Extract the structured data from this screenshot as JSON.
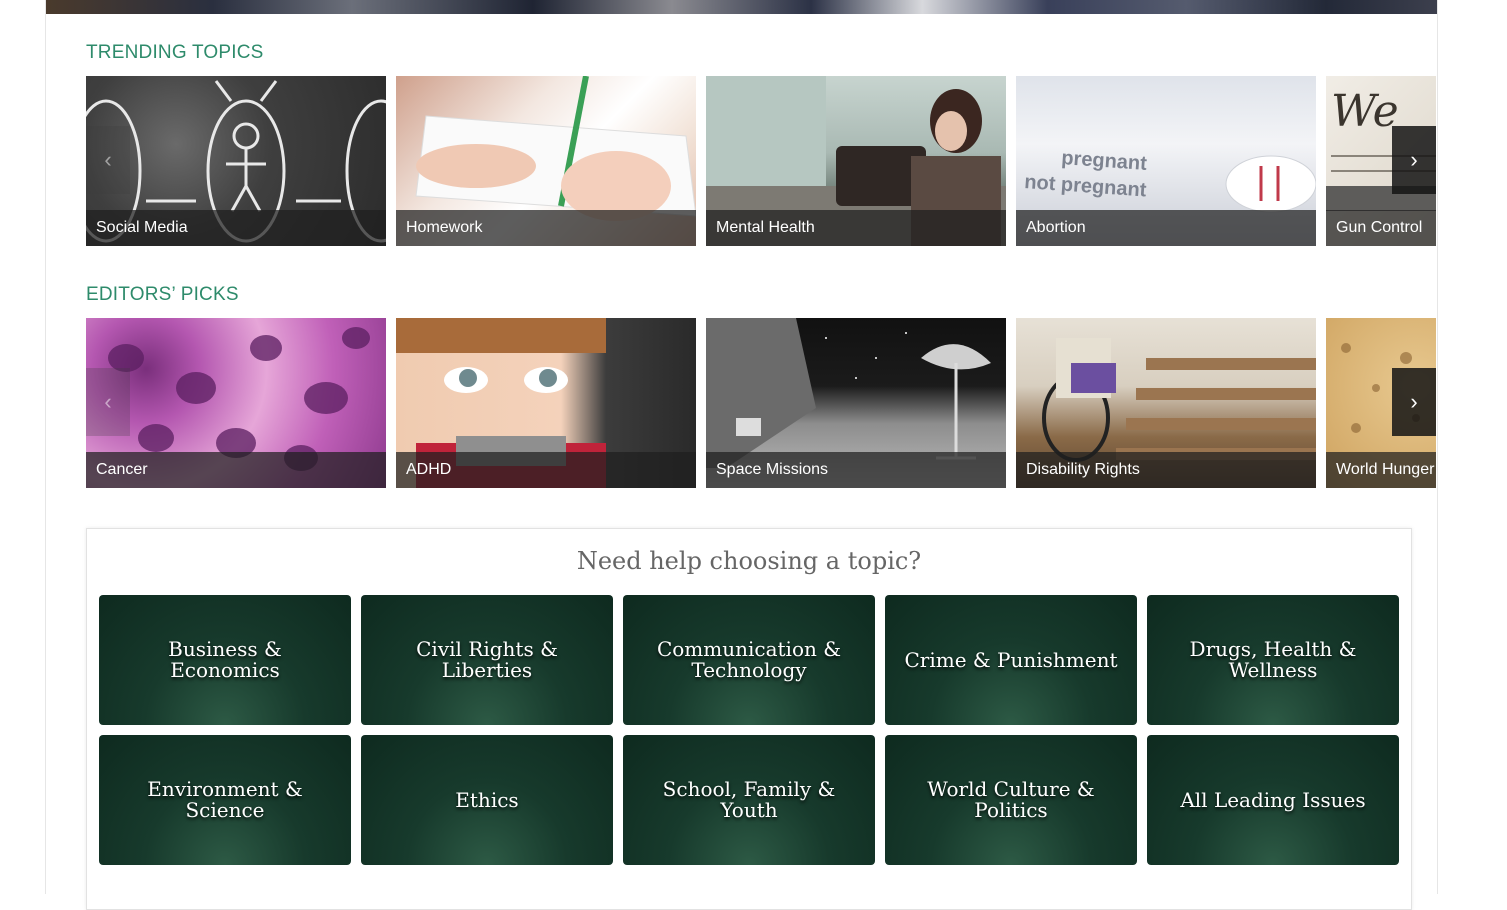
{
  "trending": {
    "title": "TRENDING TOPICS",
    "items": [
      {
        "label": "Social Media"
      },
      {
        "label": "Homework"
      },
      {
        "label": "Mental Health"
      },
      {
        "label": "Abortion"
      },
      {
        "label": "Gun Control"
      }
    ]
  },
  "editors": {
    "title": "EDITORS’ PICKS",
    "items": [
      {
        "label": "Cancer"
      },
      {
        "label": "ADHD"
      },
      {
        "label": "Space Missions"
      },
      {
        "label": "Disability Rights"
      },
      {
        "label": "World Hunger"
      }
    ]
  },
  "arrows": {
    "prev": "‹",
    "next": "›"
  },
  "help": {
    "title": "Need help choosing a topic?",
    "categories": [
      {
        "label": "Business & Economics"
      },
      {
        "label": "Civil Rights & Liberties"
      },
      {
        "label": "Communication & Technology"
      },
      {
        "label": "Crime & Punishment"
      },
      {
        "label": "Drugs, Health & Wellness"
      },
      {
        "label": "Environment & Science"
      },
      {
        "label": "Ethics"
      },
      {
        "label": "School, Family & Youth"
      },
      {
        "label": "World Culture & Politics"
      },
      {
        "label": "All Leading Issues"
      }
    ]
  },
  "colors": {
    "accent": "#2e8b6b",
    "category_bg": "#173a2c"
  }
}
